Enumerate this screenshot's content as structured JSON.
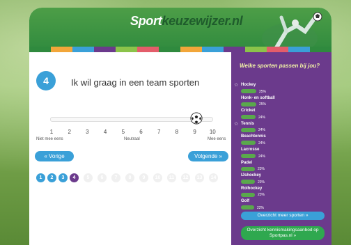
{
  "logo": {
    "part1": "Sport",
    "part2": "keuzewijzer.nl"
  },
  "question": {
    "number": "4",
    "text": "Ik wil graag in een team sporten",
    "value": 9
  },
  "scale": {
    "ticks": [
      "1",
      "2",
      "3",
      "4",
      "5",
      "6",
      "7",
      "8",
      "9",
      "10"
    ],
    "left_label": "Niet mee eens",
    "middle_label": "Neutraal",
    "right_label": "Mee eens"
  },
  "nav": {
    "prev_label": "« Vorige",
    "next_label": "Volgende »"
  },
  "progress": {
    "current": 4,
    "dots": [
      "1",
      "2",
      "3",
      "4",
      "5",
      "6",
      "7",
      "8",
      "9",
      "10",
      "11",
      "12",
      "13",
      "14"
    ]
  },
  "sidebar": {
    "title": "Welke sporten passen bij jou?",
    "sports": [
      {
        "name": "Hockey",
        "pct": "25%",
        "starred": true
      },
      {
        "name": "Honk- en softball",
        "pct": "25%",
        "starred": false
      },
      {
        "name": "Cricket",
        "pct": "24%",
        "starred": false
      },
      {
        "name": "Tennis",
        "pct": "24%",
        "starred": true
      },
      {
        "name": "Beachtennis",
        "pct": "24%",
        "starred": false
      },
      {
        "name": "Lacrosse",
        "pct": "24%",
        "starred": false
      },
      {
        "name": "Padel",
        "pct": "23%",
        "starred": false
      },
      {
        "name": "IJshockey",
        "pct": "23%",
        "starred": false
      },
      {
        "name": "Rolhockey",
        "pct": "23%",
        "starred": false
      },
      {
        "name": "Golf",
        "pct": "22%",
        "starred": false
      }
    ],
    "overview_button": "Overzicht meer sporten »",
    "kennismaking_button": "Overzicht kennismakingsaanbod op Sportpas.nl »"
  },
  "colors": {
    "brand_green": "#2f8a3e",
    "accent_blue": "#3aa0d8",
    "sidebar_purple": "#6b3a8c",
    "title_yellow": "#f1f3a6",
    "bar_green": "#5aa84c"
  }
}
